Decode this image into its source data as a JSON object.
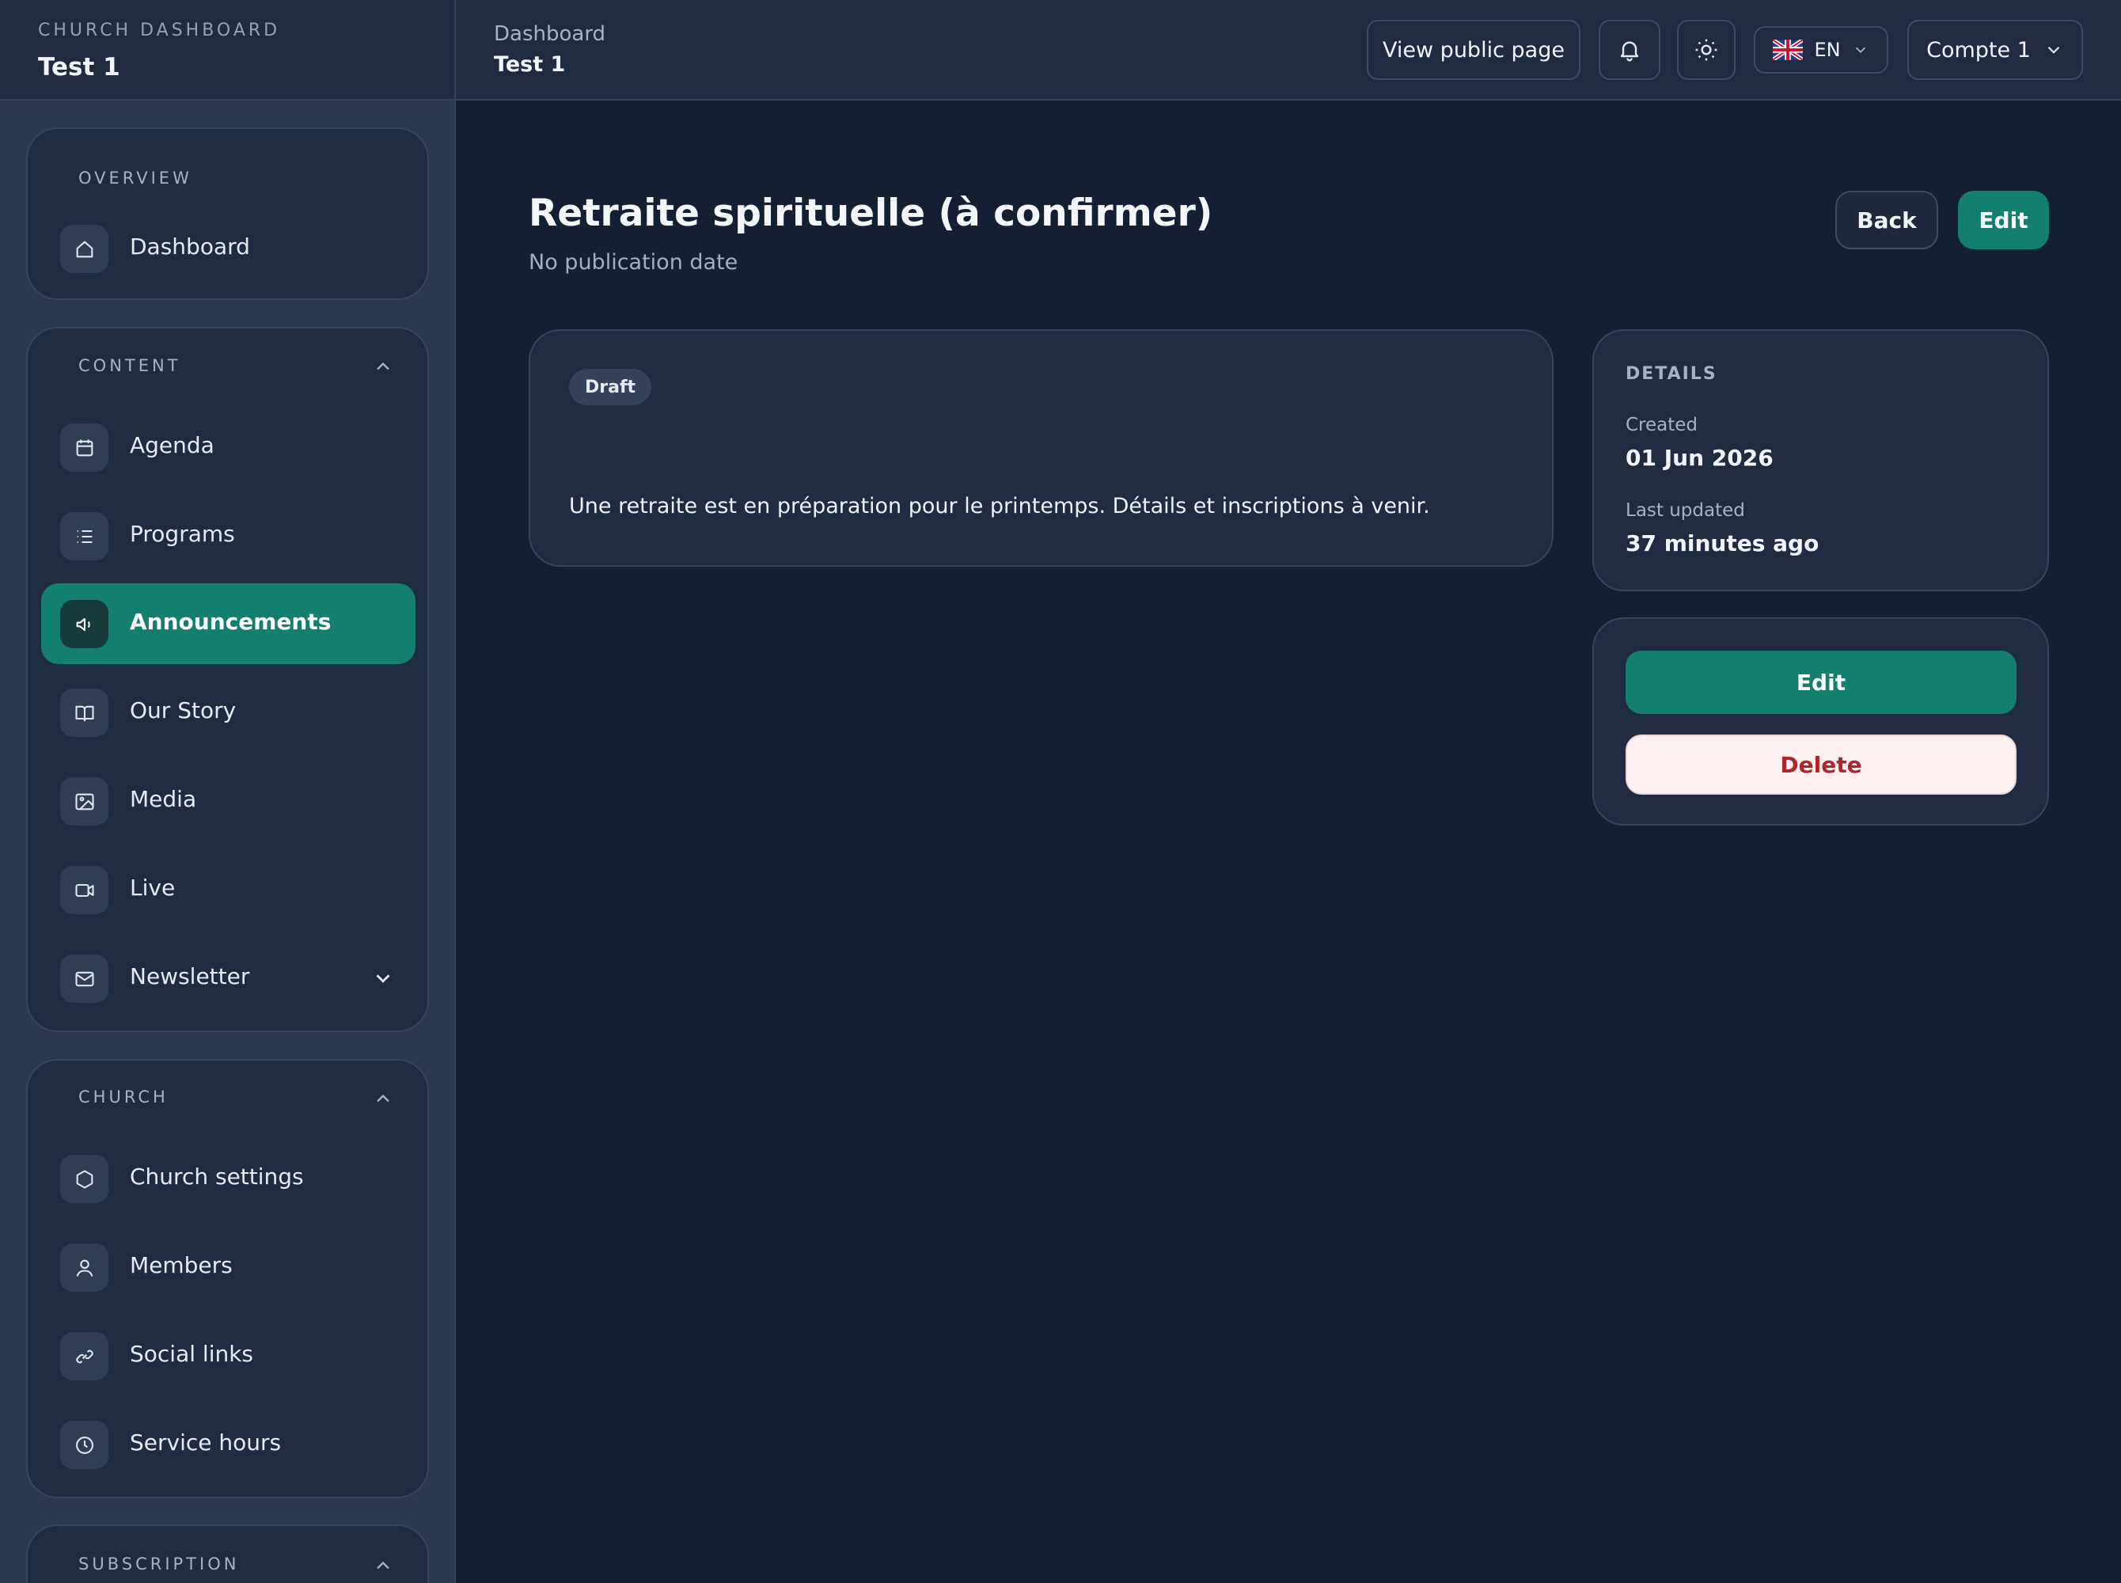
{
  "brand": {
    "eyebrow": "CHURCH DASHBOARD",
    "title": "Test 1"
  },
  "sidebar": {
    "overview": {
      "title": "OVERVIEW",
      "items": [
        {
          "label": "Dashboard",
          "icon": "home-icon"
        }
      ]
    },
    "content": {
      "title": "CONTENT",
      "items": [
        {
          "label": "Agenda",
          "icon": "calendar-icon"
        },
        {
          "label": "Programs",
          "icon": "list-icon"
        },
        {
          "label": "Announcements",
          "icon": "megaphone-icon",
          "active": true
        },
        {
          "label": "Our Story",
          "icon": "book-icon"
        },
        {
          "label": "Media",
          "icon": "image-icon"
        },
        {
          "label": "Live",
          "icon": "video-icon"
        },
        {
          "label": "Newsletter",
          "icon": "mail-icon"
        }
      ]
    },
    "church": {
      "title": "CHURCH",
      "items": [
        {
          "label": "Church settings",
          "icon": "hexagon-icon"
        },
        {
          "label": "Members",
          "icon": "user-icon"
        },
        {
          "label": "Social links",
          "icon": "link-icon"
        },
        {
          "label": "Service hours",
          "icon": "clock-icon"
        }
      ]
    },
    "subscription": {
      "title": "SUBSCRIPTION"
    }
  },
  "topbar": {
    "breadcrumb": "Dashboard",
    "current": "Test 1",
    "view_public_label": "View public page",
    "language": "EN",
    "account": "Compte 1"
  },
  "page": {
    "title": "Retraite spirituelle (à confirmer)",
    "subtitle": "No publication date",
    "back_label": "Back",
    "edit_label": "Edit"
  },
  "announcement": {
    "status": "Draft",
    "body": "Une retraite est en préparation pour le printemps. Détails et inscriptions à venir."
  },
  "details": {
    "title": "DETAILS",
    "created_label": "Created",
    "created_value": "01 Jun 2026",
    "updated_label": "Last updated",
    "updated_value": "37 minutes ago"
  },
  "actions": {
    "edit_label": "Edit",
    "delete_label": "Delete"
  },
  "colors": {
    "accent": "#13806f",
    "danger": "#b4232a",
    "background": "#131f33"
  }
}
